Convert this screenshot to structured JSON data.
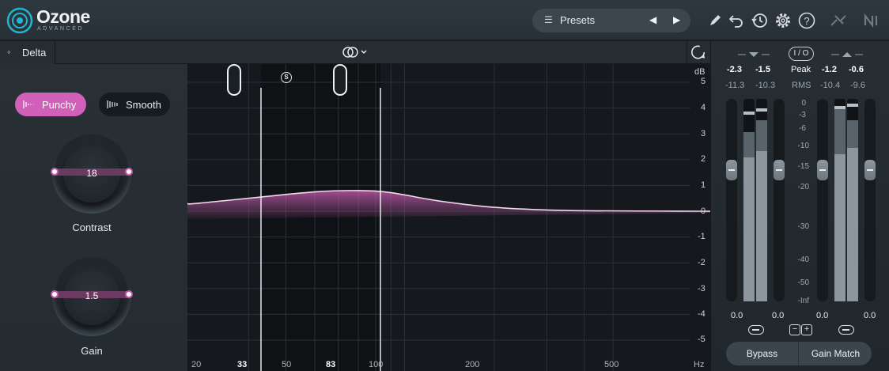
{
  "app": {
    "name": "Ozone",
    "edition": "ADVANCED"
  },
  "toolbar": {
    "presets_label": "Presets",
    "icons": [
      "list-icon",
      "prev-arrow-icon",
      "next-arrow-icon",
      "pencil-icon",
      "undo-icon",
      "history-icon",
      "gear-icon",
      "help-icon",
      "link-cables-icon",
      "ni-logo-icon"
    ]
  },
  "delta": {
    "label": "Delta"
  },
  "modes": {
    "punchy": "Punchy",
    "smooth": "Smooth",
    "active": "Punchy"
  },
  "knobs": {
    "contrast": {
      "label": "Contrast",
      "value": "18"
    },
    "gain": {
      "label": "Gain",
      "value": "1.5"
    }
  },
  "graph": {
    "y_unit": "dB",
    "y_labels": [
      "5",
      "4",
      "3",
      "2",
      "1",
      "0",
      "-1",
      "-2",
      "-3",
      "-4",
      "-5"
    ],
    "x_labels": [
      "20",
      "33",
      "50",
      "83",
      "100",
      "200",
      "500",
      "Hz"
    ],
    "highlighted_x": [
      "33",
      "83"
    ],
    "solo_label": "S",
    "band": {
      "low_hz": 33,
      "high_hz": 83
    },
    "curve_db": [
      {
        "hz": 20,
        "db": 0.3
      },
      {
        "hz": 33,
        "db": 0.55
      },
      {
        "hz": 50,
        "db": 0.75
      },
      {
        "hz": 70,
        "db": 0.8
      },
      {
        "hz": 90,
        "db": 0.72
      },
      {
        "hz": 130,
        "db": 0.4
      },
      {
        "hz": 200,
        "db": 0.15
      },
      {
        "hz": 350,
        "db": 0.03
      },
      {
        "hz": 1000,
        "db": 0.0
      }
    ],
    "accent_color": "#d160b9"
  },
  "meters": {
    "input": {
      "peak_l": "-2.3",
      "peak_r": "-1.5",
      "rms_l": "-11.3",
      "rms_r": "-10.3",
      "gain": "0.0"
    },
    "output": {
      "peak_l": "-1.2",
      "peak_r": "-0.6",
      "rms_l": "-10.4",
      "rms_r": "-9.6",
      "gain": "0.0"
    },
    "io_label": "I / O",
    "peak_label": "Peak",
    "rms_label": "RMS",
    "scale": [
      "0",
      "-3",
      "-6",
      "-10",
      "-15",
      "-20",
      "-30",
      "-40",
      "-50",
      "-Inf"
    ]
  },
  "footer": {
    "bypass": "Bypass",
    "gain_match": "Gain Match"
  }
}
